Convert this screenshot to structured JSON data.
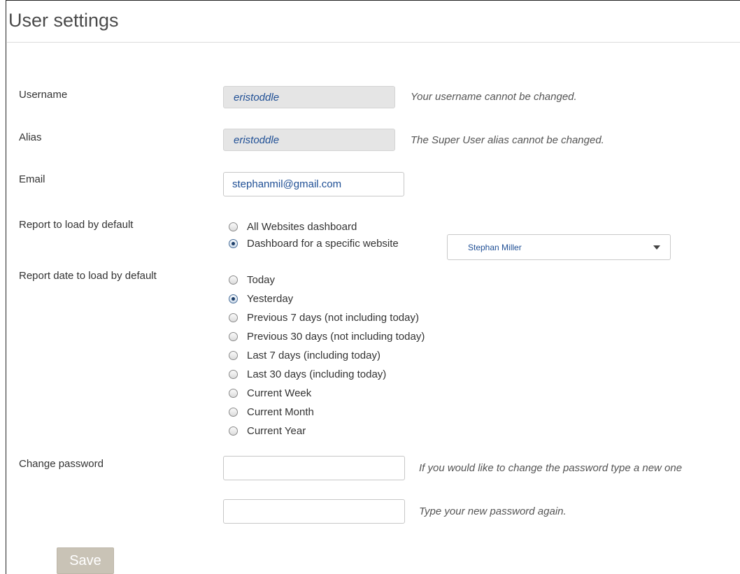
{
  "page": {
    "title": "User settings"
  },
  "username": {
    "label": "Username",
    "value": "eristoddle",
    "hint": "Your username cannot be changed."
  },
  "alias": {
    "label": "Alias",
    "value": "eristoddle",
    "hint": "The Super User alias cannot be changed."
  },
  "email": {
    "label": "Email",
    "value": "stephanmil@gmail.com"
  },
  "default_report": {
    "label": "Report to load by default",
    "options": [
      {
        "label": "All Websites dashboard",
        "checked": false
      },
      {
        "label": "Dashboard for a specific website",
        "checked": true
      }
    ],
    "website_select": {
      "value": "Stephan Miller"
    }
  },
  "default_date": {
    "label": "Report date to load by default",
    "options": [
      {
        "label": "Today",
        "checked": false
      },
      {
        "label": "Yesterday",
        "checked": true
      },
      {
        "label": "Previous 7 days (not including today)",
        "checked": false
      },
      {
        "label": "Previous 30 days (not including today)",
        "checked": false
      },
      {
        "label": "Last 7 days (including today)",
        "checked": false
      },
      {
        "label": "Last 30 days (including today)",
        "checked": false
      },
      {
        "label": "Current Week",
        "checked": false
      },
      {
        "label": "Current Month",
        "checked": false
      },
      {
        "label": "Current Year",
        "checked": false
      }
    ]
  },
  "password": {
    "label": "Change password",
    "new_value": "",
    "new_hint": "If you would like to change the password type a new one",
    "confirm_value": "",
    "confirm_hint": "Type your new password again."
  },
  "actions": {
    "save_label": "Save"
  },
  "colors": {
    "link_text": "#1f4f95",
    "readonly_bg": "#e5e5e5",
    "save_button_bg": "#c9c3b6"
  }
}
